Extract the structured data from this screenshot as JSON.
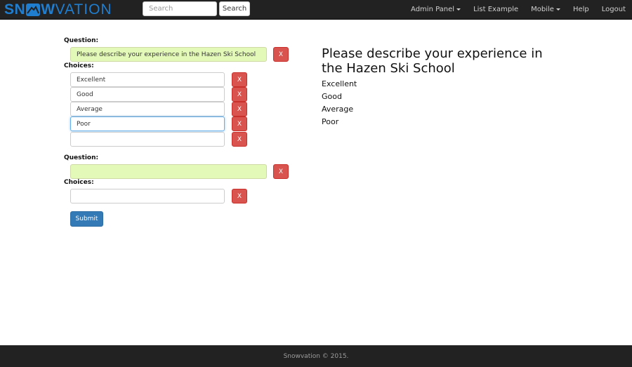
{
  "brand": {
    "part1": "SN",
    "part2": "W",
    "part3": "VATION"
  },
  "search": {
    "placeholder": "Search",
    "button_label": "Search"
  },
  "nav": {
    "admin_panel": "Admin Panel",
    "list_example": "List Example",
    "mobile": "Mobile",
    "help": "Help",
    "logout": "Logout"
  },
  "form": {
    "question_label": "Question:",
    "choices_label": "Choices:",
    "delete_label": "X",
    "questions": [
      {
        "value": "Please describe your experience in the Hazen Ski School",
        "choices": [
          "Excellent",
          "Good",
          "Average",
          "Poor",
          ""
        ]
      },
      {
        "value": "",
        "choices": [
          ""
        ]
      }
    ],
    "submit_label": "Submit"
  },
  "preview": {
    "title": "Please describe your experience in the Hazen Ski School",
    "choices": [
      "Excellent",
      "Good",
      "Average",
      "Poor"
    ]
  },
  "footer": {
    "text": "Snowvation © 2015."
  },
  "colors": {
    "navbar": "#222222",
    "brand": "#1f7ecf",
    "question_field": "#e3f9b8",
    "delete_button": "#d9534f",
    "submit_button": "#337ab7"
  }
}
